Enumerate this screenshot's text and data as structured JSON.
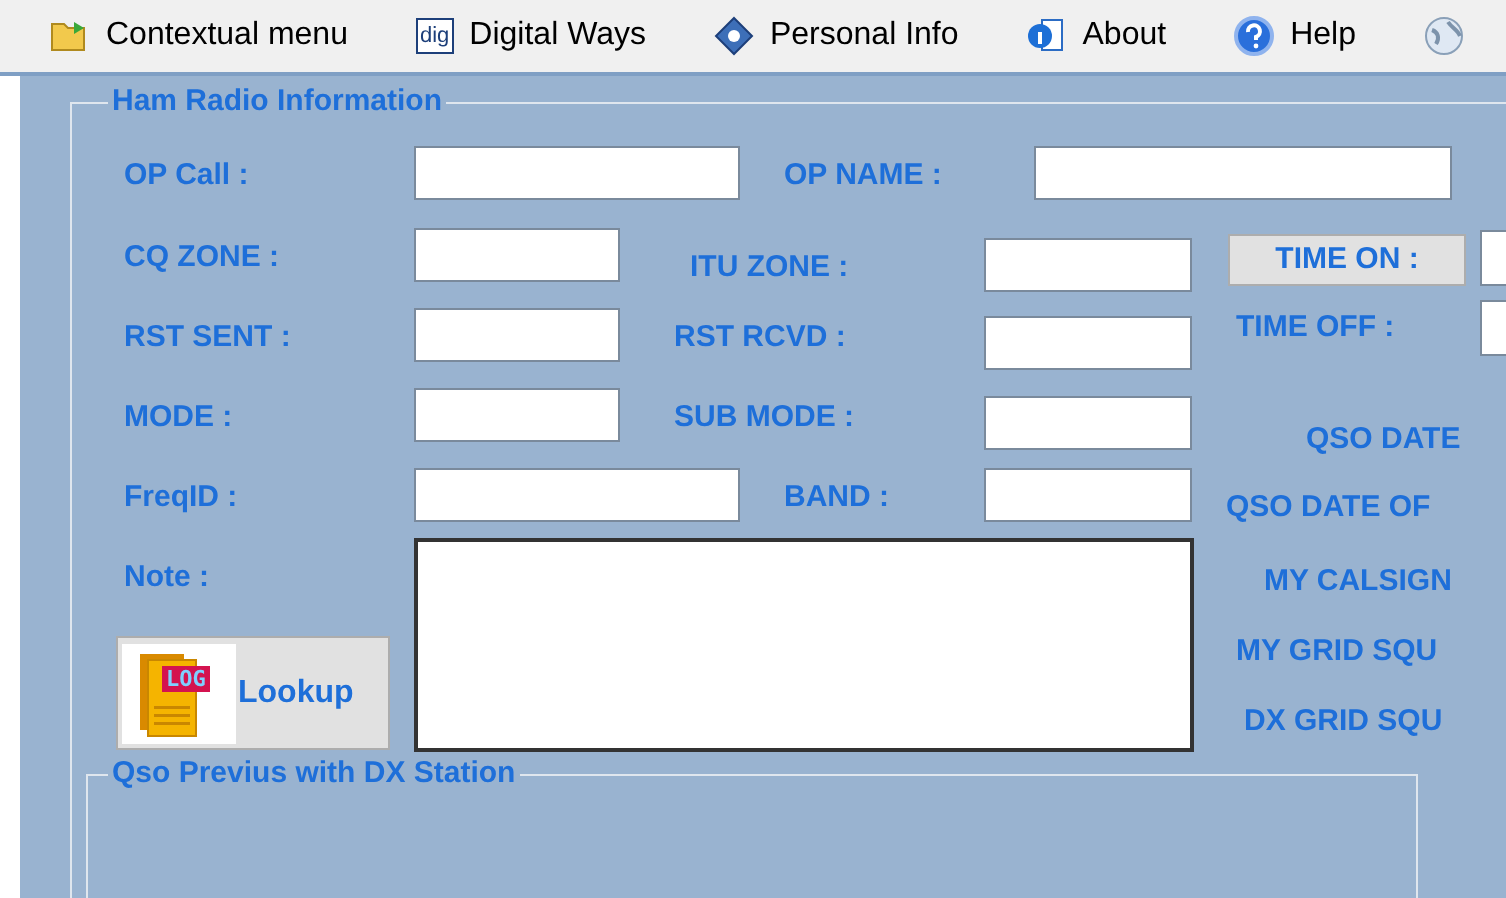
{
  "menu": [
    {
      "kind": "item",
      "label": "Contextual menu"
    },
    {
      "kind": "item",
      "label": "Digital Ways",
      "icon_text": "dig"
    },
    {
      "kind": "item",
      "label": "Personal Info"
    },
    {
      "kind": "item",
      "label": "About"
    },
    {
      "kind": "item",
      "label": "Help"
    },
    {
      "kind": "icon"
    }
  ],
  "group": {
    "title": "Ham Radio Information"
  },
  "fields": [
    {
      "kind": "label",
      "text": "OP Call :"
    },
    {
      "kind": "input"
    },
    {
      "kind": "label",
      "text": "OP NAME :"
    },
    {
      "kind": "input"
    },
    {
      "kind": "label",
      "text": "CQ ZONE :"
    },
    {
      "kind": "input"
    },
    {
      "kind": "label",
      "text": "ITU ZONE :"
    },
    {
      "kind": "input"
    },
    {
      "kind": "button",
      "text": "TIME ON :"
    },
    {
      "kind": "input"
    },
    {
      "kind": "label",
      "text": "RST SENT :"
    },
    {
      "kind": "input"
    },
    {
      "kind": "label",
      "text": "RST RCVD :"
    },
    {
      "kind": "input"
    },
    {
      "kind": "label",
      "text": "TIME OFF :"
    },
    {
      "kind": "input"
    },
    {
      "kind": "label",
      "text": "MODE :"
    },
    {
      "kind": "input"
    },
    {
      "kind": "label",
      "text": "SUB MODE :"
    },
    {
      "kind": "input"
    },
    {
      "kind": "label",
      "text": "QSO DATE"
    },
    {
      "kind": "label",
      "text": "FreqID :"
    },
    {
      "kind": "input"
    },
    {
      "kind": "label",
      "text": "BAND :"
    },
    {
      "kind": "input"
    },
    {
      "kind": "label",
      "text": "QSO DATE OF"
    },
    {
      "kind": "label",
      "text": "Note :"
    },
    {
      "kind": "textarea"
    },
    {
      "kind": "label",
      "text": "MY CALSIGN"
    },
    {
      "kind": "label",
      "text": "MY GRID SQU"
    },
    {
      "kind": "label",
      "text": "DX GRID SQU"
    }
  ],
  "lookup": {
    "label": "Lookup",
    "icon_text": "LOG"
  },
  "previous_group": {
    "title": "Qso Previus with DX Station"
  }
}
